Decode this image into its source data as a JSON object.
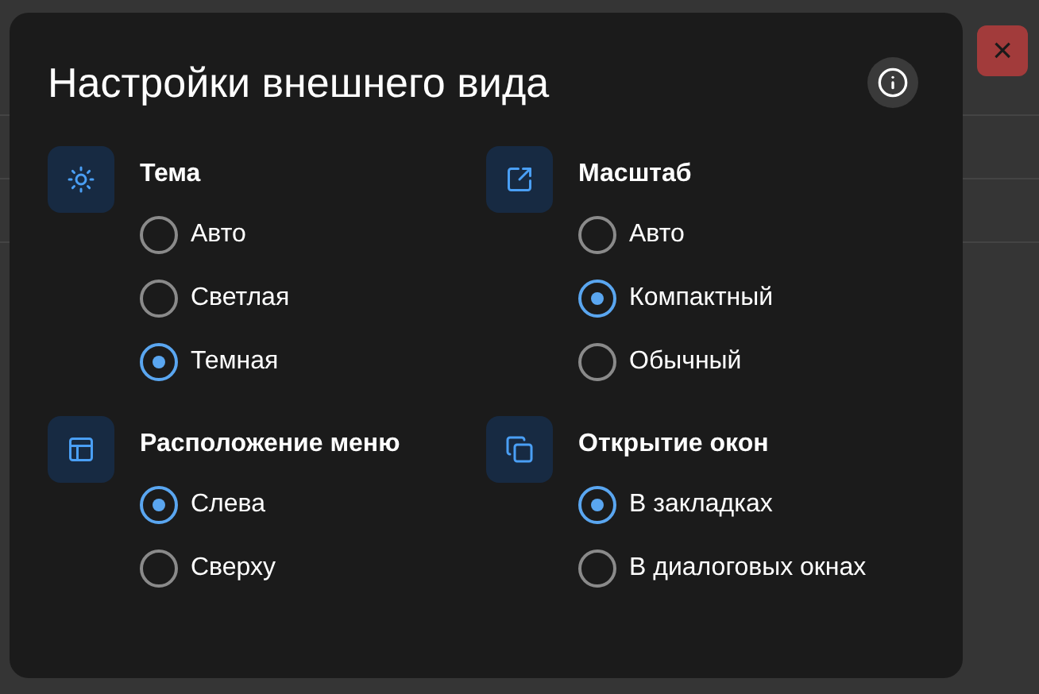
{
  "close_button": {
    "label": "×"
  },
  "dialog": {
    "title": "Настройки внешнего вида",
    "sections": [
      {
        "kind": "theme",
        "title": "Тема",
        "options": [
          {
            "label": "Авто",
            "selected": false
          },
          {
            "label": "Светлая",
            "selected": false
          },
          {
            "label": "Темная",
            "selected": true
          }
        ]
      },
      {
        "kind": "scale",
        "title": "Масштаб",
        "options": [
          {
            "label": "Авто",
            "selected": false
          },
          {
            "label": "Компактный",
            "selected": true
          },
          {
            "label": "Обычный",
            "selected": false
          }
        ]
      },
      {
        "kind": "menu",
        "title": "Расположение меню",
        "options": [
          {
            "label": "Слева",
            "selected": true
          },
          {
            "label": "Сверху",
            "selected": false
          }
        ]
      },
      {
        "kind": "windows",
        "title": "Открытие окон",
        "options": [
          {
            "label": "В закладках",
            "selected": true
          },
          {
            "label": "В диалоговых окнах",
            "selected": false
          }
        ]
      }
    ]
  }
}
